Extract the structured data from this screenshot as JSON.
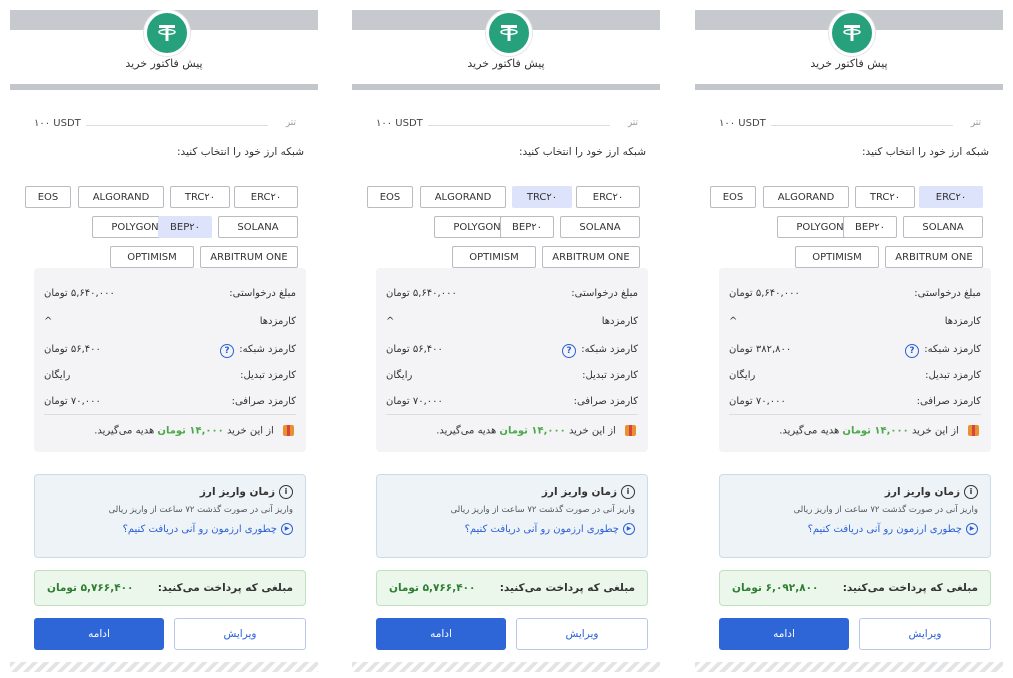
{
  "common": {
    "title": "پیش فاکتور خرید",
    "tether_label": "تتر",
    "amount": "۱۰۰ USDT",
    "network_prompt": "شبکه ارز خود را انتخاب کنید:",
    "networks": [
      "EOS",
      "ALGORAND",
      "TRC۲۰",
      "ERC۲۰",
      "POLYGON",
      "BEP۲۰",
      "SOLANA",
      "OPTIMISM",
      "ARBITRUM ONE"
    ],
    "requested_label": "مبلغ درخواستی:",
    "requested_value": "۵,۶۴۰,۰۰۰ تومان",
    "fees_label": "کارمزدها",
    "fees_caret": "^",
    "network_fee_label": "کارمزد شبکه:",
    "conversion_fee_label": "کارمزد تبدیل:",
    "conversion_fee_value": "رایگان",
    "exchange_fee_label": "کارمزد صرافی:",
    "exchange_fee_value": "۷۰,۰۰۰ تومان",
    "gift_prefix": "از این خرید",
    "gift_amount": "۱۴,۰۰۰ تومان",
    "gift_suffix": "هدیه می‌گیرید.",
    "info_title": "زمان واریز ارز",
    "info_body": "واریز آنی در صورت گذشت ۷۲ ساعت از واریز ریالی",
    "info_link": "چطوری ارزمون رو آنی دریافت کنیم؟",
    "total_label": "مبلغی که پرداخت می‌کنید:",
    "continue_label": "ادامه",
    "edit_label": "ویرایش",
    "help_glyph": "?",
    "info_glyph": "i",
    "play_glyph": "▶"
  },
  "panels": [
    {
      "selected_network": "BEP۲۰",
      "network_fee": "۵۶,۴۰۰ تومان",
      "total": "۵,۷۶۶,۴۰۰ تومان"
    },
    {
      "selected_network": "TRC۲۰",
      "network_fee": "۵۶,۴۰۰ تومان",
      "total": "۵,۷۶۶,۴۰۰ تومان"
    },
    {
      "selected_network": "ERC۲۰",
      "network_fee": "۳۸۲,۸۰۰ تومان",
      "total": "۶,۰۹۲,۸۰۰ تومان"
    }
  ],
  "colors": {
    "tether_green": "#26a17b",
    "primary_blue": "#2f66d7",
    "selected_bg": "#dce3fb",
    "total_green": "#2e7d32",
    "gift_green": "#4aa84a"
  }
}
